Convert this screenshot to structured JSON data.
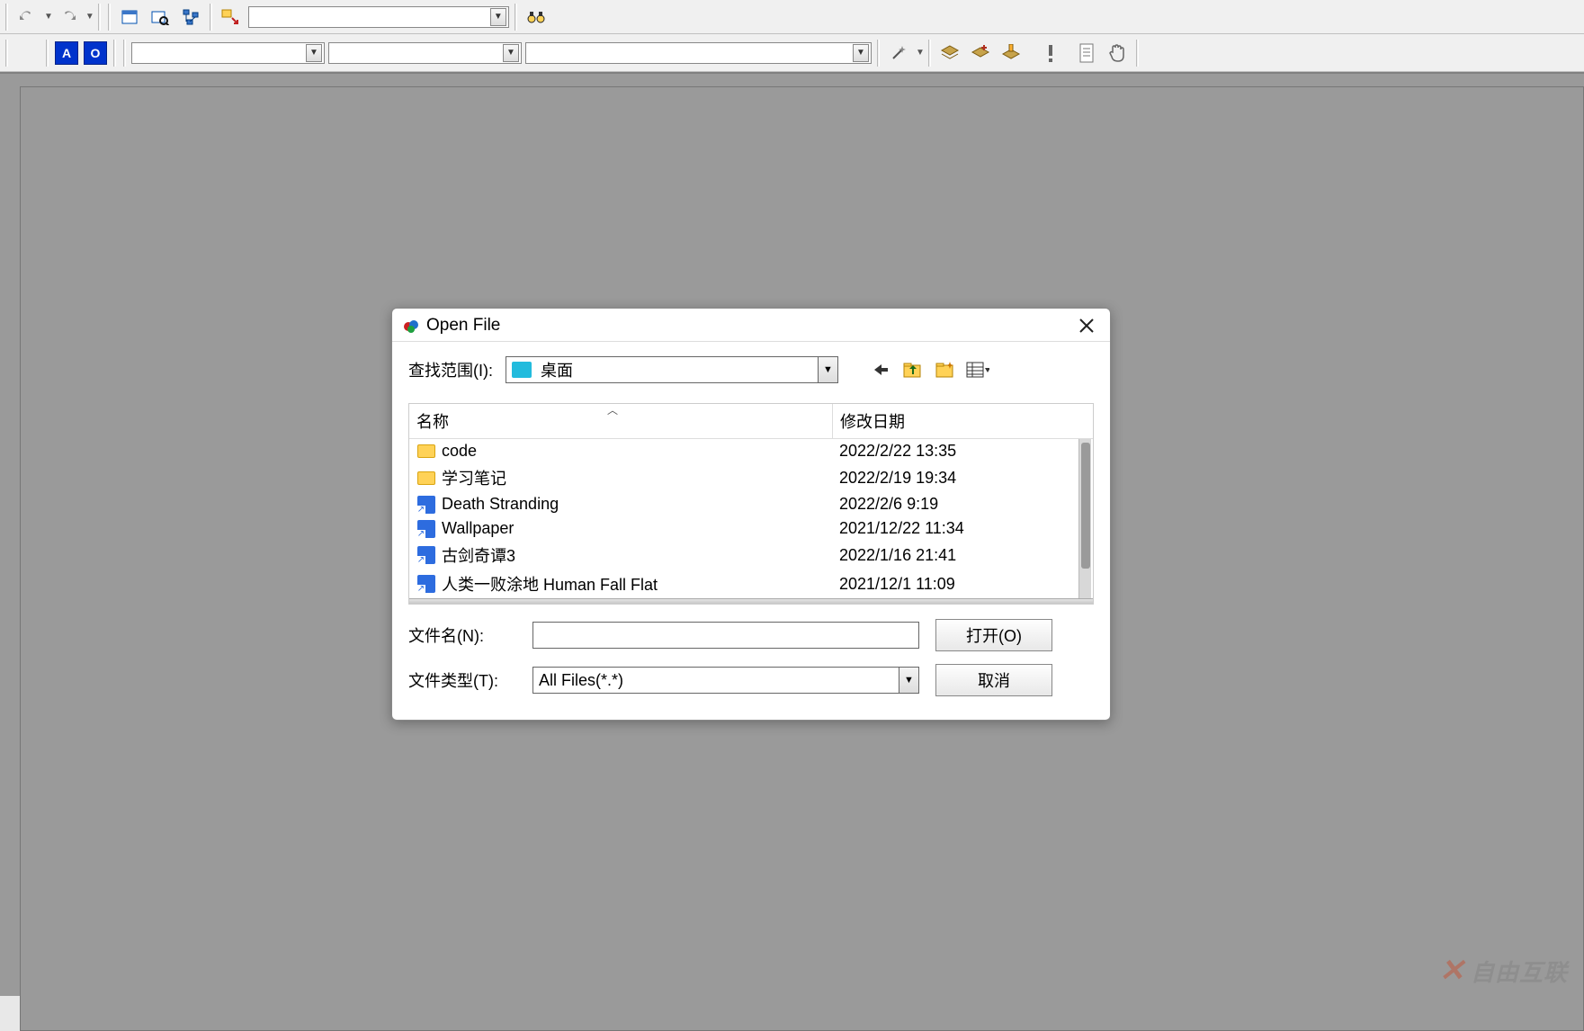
{
  "toolbar1": {
    "undo": "undo",
    "redo": "redo"
  },
  "toolbar2": {
    "chip_a": "A",
    "chip_o": "O"
  },
  "dialog": {
    "title": "Open File",
    "look_in_label": "查找范围(I):",
    "look_in_value": "桌面",
    "columns": {
      "name": "名称",
      "date": "修改日期"
    },
    "files": [
      {
        "icon": "folder",
        "name": "code",
        "date": "2022/2/22 13:35"
      },
      {
        "icon": "folder",
        "name": "学习笔记",
        "date": "2022/2/19 19:34"
      },
      {
        "icon": "shortcut",
        "name": "Death Stranding",
        "date": "2022/2/6 9:19"
      },
      {
        "icon": "shortcut",
        "name": "Wallpaper",
        "date": "2021/12/22 11:34"
      },
      {
        "icon": "shortcut",
        "name": "古剑奇谭3",
        "date": "2022/1/16 21:41"
      },
      {
        "icon": "shortcut",
        "name": "人类一败涂地  Human Fall Flat",
        "date": "2021/12/1 11:09"
      }
    ],
    "filename_label": "文件名(N):",
    "filename_value": "",
    "filetype_label": "文件类型(T):",
    "filetype_value": "All Files(*.*)",
    "open_btn": "打开(O)",
    "cancel_btn": "取消"
  },
  "watermark": "自由互联"
}
